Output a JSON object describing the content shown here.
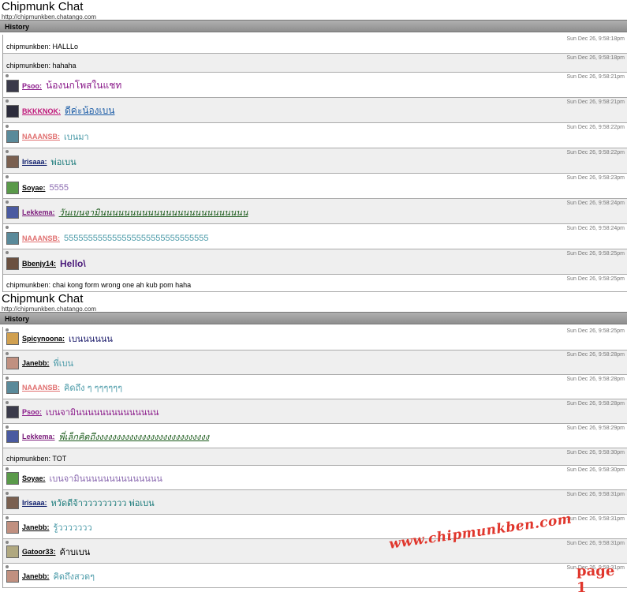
{
  "panels": [
    {
      "title": "Chipmunk Chat",
      "url": "http://chipmunkben.chatango.com",
      "history_label": "History",
      "messages": [
        {
          "user": "",
          "text": "chipmunkben: HALLLo",
          "ts": "Sun Dec 26, 9:58:18pm",
          "plain": true,
          "h": 24
        },
        {
          "user": "",
          "text": "chipmunkben: hahaha",
          "ts": "Sun Dec 26, 9:58:18pm",
          "plain": true,
          "h": 24
        },
        {
          "user": "Psoo:",
          "text": "น้องนกโพสในแชท",
          "ts": "Sun Dec 26, 9:58:21pm",
          "h": 32,
          "ucol": "#8a1a8a",
          "tcol": "#8a1a8a",
          "av": "#3a3a4a",
          "tsize": 12
        },
        {
          "user": "BKKKNOK:",
          "text": "ดีค่ะน้องเบน",
          "ts": "Sun Dec 26, 9:58:21pm",
          "h": 32,
          "ucol": "#c0187a",
          "tcol": "#1f5fa8",
          "av": "#2b2b3b",
          "tsize": 12,
          "tu": true
        },
        {
          "user": "NAAANSB:",
          "text": "เบนมา",
          "ts": "Sun Dec 26, 9:58:22pm",
          "h": 32,
          "ucol": "#e07070",
          "tcol": "#4a9aa8",
          "av": "#5a8a9a"
        },
        {
          "user": "Irisaaa:",
          "text": "พ่อเบน",
          "ts": "Sun Dec 26, 9:58:22pm",
          "h": 32,
          "ucol": "#0a1a6a",
          "tcol": "#1a7a7a",
          "av": "#7a6050"
        },
        {
          "user": "Soyae:",
          "text": "5555",
          "ts": "Sun Dec 26, 9:58:23pm",
          "h": 32,
          "ucol": "#000000",
          "tcol": "#8a6ab0",
          "av": "#5a9a4a"
        },
        {
          "user": "Lekkema:",
          "text": "วันเบนจามินนนนนนนนนนนนนนนนนนนนนนนนน",
          "ts": "Sun Dec 26, 9:58:24pm",
          "h": 32,
          "ucol": "#7a1a7a",
          "tcol": "#1a5a1a",
          "av": "#4a5aa0",
          "ti": true,
          "tu": true
        },
        {
          "user": "NAAANSB:",
          "text": "555555555555555555555555555555",
          "ts": "Sun Dec 26, 9:58:24pm",
          "h": 32,
          "ucol": "#e07070",
          "tcol": "#4a9aa8",
          "av": "#5a8a9a"
        },
        {
          "user": "Bbenjy14:",
          "text": "Hello\\",
          "ts": "Sun Dec 26, 9:58:25pm",
          "h": 32,
          "ucol": "#000000",
          "tcol": "#4a1a7a",
          "av": "#6a5040",
          "tb": true,
          "tsize": 12
        },
        {
          "user": "",
          "text": "chipmunkben: chai kong form wrong one ah kub pom haha",
          "ts": "Sun Dec 26, 9:58:25pm",
          "plain": true,
          "h": 22
        }
      ]
    },
    {
      "title": "Chipmunk Chat",
      "url": "http://chipmunkben.chatango.com",
      "history_label": "History",
      "messages": [
        {
          "user": "Spicynoona:",
          "text": "เบนนนนนน",
          "ts": "Sun Dec 26, 9:58:25pm",
          "h": 30,
          "ucol": "#000000",
          "tcol": "#1a1a6a",
          "av": "#d0a050"
        },
        {
          "user": "Janebb:",
          "text": "พี่เบน",
          "ts": "Sun Dec 26, 9:58:28pm",
          "h": 31,
          "ucol": "#000000",
          "tcol": "#4a9aa8",
          "av": "#c09080"
        },
        {
          "user": "NAAANSB:",
          "text": "คิดถึง ๆ ๆๆๆๆๆๆ",
          "ts": "Sun Dec 26, 9:58:28pm",
          "h": 31,
          "ucol": "#e07070",
          "tcol": "#4a9aa8",
          "av": "#5a8a9a"
        },
        {
          "user": "Psoo:",
          "text": "เบนจามินนนนนนนนนนนนนน",
          "ts": "Sun Dec 26, 9:58:28pm",
          "h": 31,
          "ucol": "#8a1a8a",
          "tcol": "#8a1a8a",
          "av": "#3a3a4a"
        },
        {
          "user": "Lekkema:",
          "text": "พี่เล็กคิดถึงงงงงงงงงงงงงงงงงงงงงงงงงงง",
          "ts": "Sun Dec 26, 9:58:29pm",
          "h": 31,
          "ucol": "#7a1a7a",
          "tcol": "#1a5a1a",
          "av": "#4a5aa0",
          "ti": true,
          "tu": true
        },
        {
          "user": "",
          "text": "chipmunkben: TOT",
          "ts": "Sun Dec 26, 9:58:30pm",
          "plain": true,
          "h": 22
        },
        {
          "user": "Soyae:",
          "text": "เบนจามินนนนนนนนนนนนนน",
          "ts": "Sun Dec 26, 9:58:30pm",
          "h": 31,
          "ucol": "#000000",
          "tcol": "#8a6ab0",
          "av": "#5a9a4a"
        },
        {
          "user": "Irisaaa:",
          "text": "หวัดดีจ้าววววววววว พ่อเบน",
          "ts": "Sun Dec 26, 9:58:31pm",
          "h": 31,
          "ucol": "#0a1a6a",
          "tcol": "#1a7a7a",
          "av": "#7a6050"
        },
        {
          "user": "Janebb:",
          "text": "รู้ววววววว",
          "ts": "Sun Dec 26, 9:58:31pm",
          "h": 31,
          "ucol": "#000000",
          "tcol": "#4a9aa8",
          "av": "#c09080"
        },
        {
          "user": "Gatoor33:",
          "text": "ค้าบเบน",
          "ts": "Sun Dec 26, 9:58:31pm",
          "h": 31,
          "ucol": "#000000",
          "tcol": "#000000",
          "av": "#b0a880"
        },
        {
          "user": "Janebb:",
          "text": "คิดถึงสวดๆ",
          "ts": "Sun Dec 26, 9:58:31pm",
          "h": 31,
          "ucol": "#000000",
          "tcol": "#4a9aa8",
          "av": "#c09080"
        }
      ]
    }
  ],
  "watermark": "www.chipmunkben.com",
  "page_label": "page 1"
}
